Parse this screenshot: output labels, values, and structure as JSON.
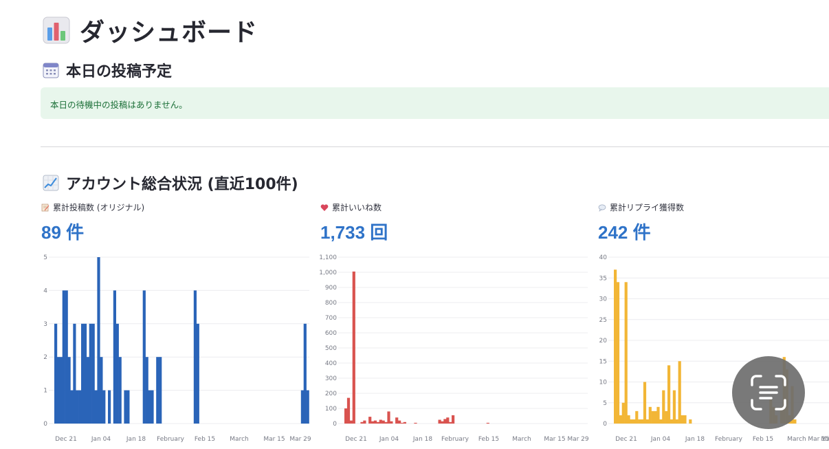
{
  "page": {
    "title": "ダッシュボード",
    "title_icon": "bar-chart-emoji-icon"
  },
  "today_section": {
    "title": "本日の投稿予定",
    "icon": "calendar-icon",
    "info_message": "本日の待機中の投稿はありません。"
  },
  "account_section": {
    "title": "アカウント総合状況 (直近100件)",
    "icon": "chart-increasing-icon"
  },
  "metrics": [
    {
      "label": "累計投稿数 (オリジナル)",
      "icon": "memo-icon",
      "value": "89 件"
    },
    {
      "label": "累計いいね数",
      "icon": "heart-icon",
      "value": "1,733 回"
    },
    {
      "label": "累計リプライ獲得数",
      "icon": "speech-bubble-icon",
      "value": "242 件"
    }
  ],
  "colors": {
    "accent": "#2f73c8",
    "posts_bar": "#2a64b8",
    "likes_bar": "#d9534f",
    "replies_bar": "#f2b636",
    "info_bg": "#e8f6ec",
    "info_text": "#1b6f37"
  },
  "chart_data": [
    {
      "type": "bar",
      "series": [
        {
          "values": [
            3,
            2,
            2,
            4,
            4,
            2,
            1,
            3,
            1,
            1,
            3,
            3,
            2,
            3,
            3,
            1,
            5,
            2,
            1,
            0,
            1,
            0,
            4,
            3,
            2,
            0,
            1,
            1,
            0,
            0,
            0,
            0,
            0,
            4,
            2,
            1,
            1,
            0,
            2,
            2,
            0,
            0,
            0,
            0,
            0,
            0,
            0,
            0,
            0,
            0,
            0,
            0,
            4,
            3,
            0,
            0,
            0,
            0,
            0,
            0,
            0,
            0,
            0,
            0,
            0,
            0,
            0,
            0,
            0,
            0,
            0,
            0,
            0,
            0,
            0,
            0,
            0,
            0,
            0,
            0,
            0,
            0,
            0,
            0,
            0,
            0,
            0,
            0,
            0,
            0,
            0,
            0,
            1,
            3,
            1
          ]
        }
      ],
      "x_ticks": [
        "Dec 21",
        "Jan 04",
        "Jan 18",
        "February",
        "Feb 15",
        "March",
        "Mar 15",
        "Mar 29"
      ],
      "y_ticks": [
        "0",
        "1",
        "2",
        "3",
        "4",
        "5"
      ],
      "ylim": [
        0,
        5
      ]
    },
    {
      "type": "bar",
      "series": [
        {
          "values": [
            100,
            170,
            20,
            1005,
            0,
            0,
            10,
            20,
            0,
            45,
            15,
            20,
            10,
            25,
            20,
            10,
            80,
            15,
            0,
            40,
            20,
            5,
            10,
            0,
            0,
            0,
            5,
            0,
            0,
            0,
            0,
            0,
            0,
            0,
            0,
            25,
            15,
            30,
            40,
            10,
            55,
            0,
            0,
            0,
            0,
            0,
            0,
            0,
            0,
            0,
            0,
            0,
            0,
            5,
            0,
            0,
            0,
            0,
            0,
            0,
            0,
            0,
            0,
            0,
            0,
            0,
            0,
            0,
            0,
            0,
            0,
            0,
            0,
            0,
            0,
            0,
            0,
            0,
            0,
            0,
            0,
            0,
            0,
            0,
            0,
            0,
            0,
            0,
            0,
            0,
            0,
            0,
            0,
            0,
            0
          ]
        }
      ],
      "x_ticks": [
        "Dec 21",
        "Jan 04",
        "Jan 18",
        "February",
        "Feb 15",
        "March",
        "Mar 15",
        "Mar 29"
      ],
      "y_ticks": [
        "0",
        "100",
        "200",
        "300",
        "400",
        "500",
        "600",
        "700",
        "800",
        "900",
        "1,000",
        "1,100"
      ],
      "ylim": [
        0,
        1100
      ]
    },
    {
      "type": "bar",
      "series": [
        {
          "values": [
            37,
            34,
            2,
            5,
            34,
            2,
            1,
            1,
            3,
            1,
            1,
            10,
            1,
            4,
            3,
            3,
            4,
            1,
            8,
            3,
            14,
            1,
            8,
            1,
            15,
            2,
            2,
            0,
            1,
            0,
            0,
            0,
            0,
            0,
            0,
            0,
            0,
            0,
            0,
            0,
            0,
            0,
            0,
            0,
            0,
            0,
            0,
            0,
            0,
            0,
            0,
            0,
            0,
            0,
            0,
            0,
            0,
            0,
            6,
            4,
            2,
            0,
            4,
            16,
            13,
            2,
            9,
            1,
            0,
            0,
            0,
            0,
            0,
            0,
            0,
            0,
            0,
            0,
            0,
            0,
            0,
            0,
            0,
            0,
            0,
            0,
            0,
            0,
            0,
            0,
            0,
            0,
            0,
            0,
            0
          ]
        }
      ],
      "x_ticks": [
        "Dec 21",
        "Jan 04",
        "Jan 18",
        "February",
        "Feb 15",
        "March",
        "Mar 15",
        "Ma"
      ],
      "y_ticks": [
        "0",
        "5",
        "10",
        "15",
        "20",
        "25",
        "30",
        "35",
        "40"
      ],
      "ylim": [
        0,
        40
      ]
    }
  ],
  "overlay": {
    "icon": "text-scan-icon"
  }
}
